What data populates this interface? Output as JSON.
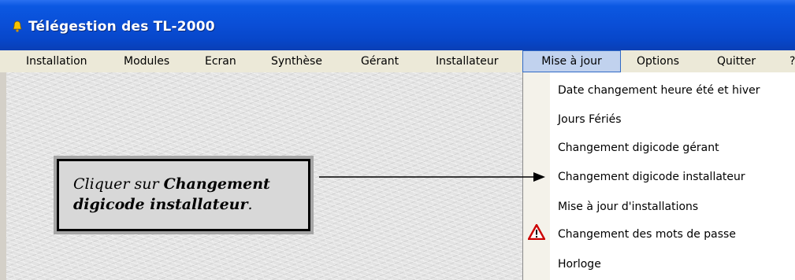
{
  "window": {
    "title": "Télégestion des TL-2000"
  },
  "menubar": {
    "items": [
      {
        "label": "Installation"
      },
      {
        "label": "Modules"
      },
      {
        "label": "Ecran"
      },
      {
        "label": "Synthèse"
      },
      {
        "label": "Gérant"
      },
      {
        "label": "Installateur"
      },
      {
        "label": "Mise à jour"
      },
      {
        "label": "Options"
      },
      {
        "label": "Quitter"
      },
      {
        "label": "?"
      }
    ]
  },
  "dropdown": {
    "items": [
      {
        "label": "Date changement heure été et hiver"
      },
      {
        "label": "Jours Fériés"
      },
      {
        "label": "Changement digicode gérant"
      },
      {
        "label": "Changement digicode installateur"
      },
      {
        "label": "Mise à jour d'installations"
      },
      {
        "label": "Changement des mots de passe",
        "icon": "warning-icon"
      },
      {
        "label": "Horloge"
      }
    ]
  },
  "callout": {
    "prefix": "Cliquer sur ",
    "bold": "Changement digicode installateur",
    "suffix": "."
  },
  "colors": {
    "titlebar": "#0a4ed6",
    "menubar": "#ece9d8",
    "menu_highlight": "#c1d2ee",
    "warning": "#cc0000"
  }
}
